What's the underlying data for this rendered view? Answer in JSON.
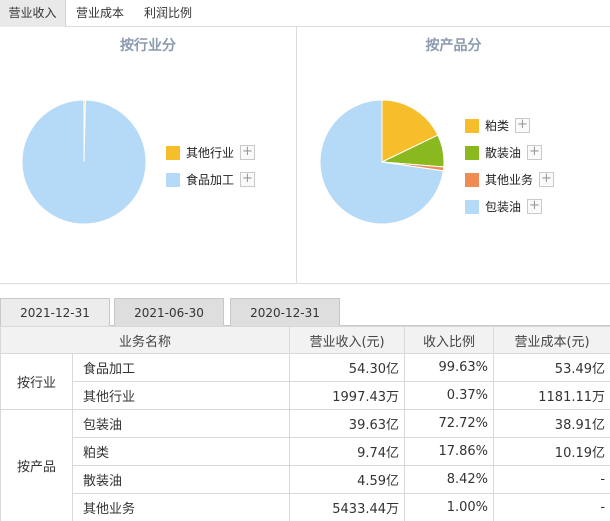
{
  "top_tabs": [
    "营业收入",
    "营业成本",
    "利润比例"
  ],
  "active_top_tab": 0,
  "charts": [
    {
      "title": "按行业分",
      "slices": [
        {
          "label": "其他行业",
          "percent": 0.37,
          "color": "#f5be2a"
        },
        {
          "label": "食品加工",
          "percent": 99.63,
          "color": "#b5daf8"
        }
      ]
    },
    {
      "title": "按产品分",
      "slices": [
        {
          "label": "粕类",
          "percent": 17.86,
          "color": "#f5be2a"
        },
        {
          "label": "散装油",
          "percent": 8.42,
          "color": "#8ab81f"
        },
        {
          "label": "其他业务",
          "percent": 1.0,
          "color": "#ee8a52"
        },
        {
          "label": "包装油",
          "percent": 72.72,
          "color": "#b5daf8"
        }
      ]
    }
  ],
  "legend_plus": "+",
  "date_tabs": [
    "2021-12-31",
    "2021-06-30",
    "2020-12-31"
  ],
  "active_date_tab": 0,
  "table": {
    "headers": [
      "业务名称",
      "营业收入(元)",
      "收入比例",
      "营业成本(元)"
    ],
    "groups": [
      {
        "name": "按行业",
        "rows": [
          {
            "name": "食品加工",
            "revenue": "54.30亿",
            "ratio": "99.63%",
            "cost": "53.49亿"
          },
          {
            "name": "其他行业",
            "revenue": "1997.43万",
            "ratio": "0.37%",
            "cost": "1181.11万"
          }
        ]
      },
      {
        "name": "按产品",
        "rows": [
          {
            "name": "包装油",
            "revenue": "39.63亿",
            "ratio": "72.72%",
            "cost": "38.91亿"
          },
          {
            "name": "粕类",
            "revenue": "9.74亿",
            "ratio": "17.86%",
            "cost": "10.19亿"
          },
          {
            "name": "散装油",
            "revenue": "4.59亿",
            "ratio": "8.42%",
            "cost": "-"
          },
          {
            "name": "其他业务",
            "revenue": "5433.44万",
            "ratio": "1.00%",
            "cost": "-"
          }
        ]
      }
    ]
  },
  "chart_data": [
    {
      "type": "pie",
      "title": "按行业分",
      "categories": [
        "其他行业",
        "食品加工"
      ],
      "values": [
        0.37,
        99.63
      ]
    },
    {
      "type": "pie",
      "title": "按产品分",
      "categories": [
        "粕类",
        "散装油",
        "其他业务",
        "包装油"
      ],
      "values": [
        17.86,
        8.42,
        1.0,
        72.72
      ]
    }
  ]
}
